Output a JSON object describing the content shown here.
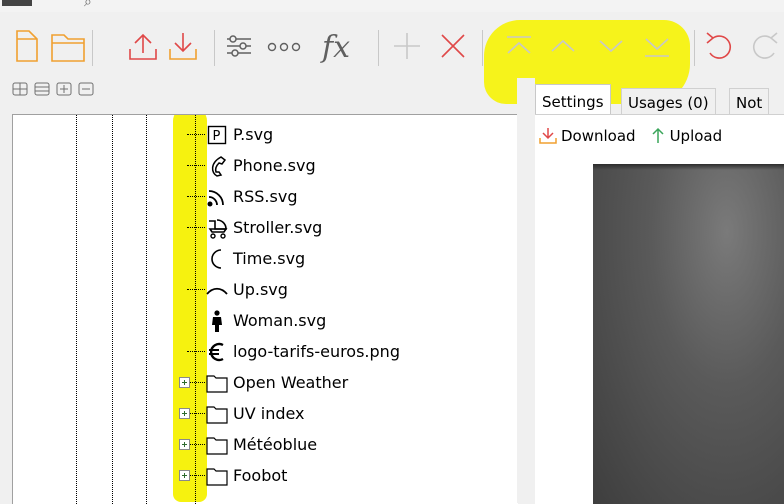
{
  "toolbar": {
    "buttons": [
      {
        "name": "new-file-button",
        "icon": "new-file-icon"
      },
      {
        "name": "open-folder-button",
        "icon": "folder-icon"
      },
      {
        "name": "export-button",
        "icon": "export-icon"
      },
      {
        "name": "import-button",
        "icon": "download-icon"
      },
      {
        "name": "settings-button",
        "icon": "sliders-icon"
      },
      {
        "name": "more-button",
        "icon": "dots-icon",
        "label": "ooo"
      },
      {
        "name": "formula-button",
        "icon": "function-icon",
        "label": "fx"
      },
      {
        "name": "add-button",
        "icon": "plus-icon"
      },
      {
        "name": "delete-button",
        "icon": "close-icon"
      },
      {
        "name": "move-top-button",
        "icon": "move-top-icon"
      },
      {
        "name": "move-up-button",
        "icon": "chevron-up-icon"
      },
      {
        "name": "move-down-button",
        "icon": "chevron-down-icon"
      },
      {
        "name": "move-bottom-button",
        "icon": "move-bottom-icon"
      },
      {
        "name": "undo-button",
        "icon": "undo-icon"
      },
      {
        "name": "redo-button",
        "icon": "redo-icon"
      }
    ],
    "colors": {
      "orange": "#f0a030",
      "red": "#e04848",
      "gray": "#c0c0c0",
      "dark": "#606060",
      "highlight": "#f6f20f"
    }
  },
  "tree": {
    "tools": [
      "expand-all-icon",
      "collapse-all-icon",
      "expand-icon",
      "collapse-icon"
    ],
    "items": [
      {
        "label": "P.svg",
        "icon": "parking-icon"
      },
      {
        "label": "Phone.svg",
        "icon": "phone-icon"
      },
      {
        "label": "RSS.svg",
        "icon": "rss-icon"
      },
      {
        "label": "Stroller.svg",
        "icon": "stroller-icon"
      },
      {
        "label": "Time.svg",
        "icon": "moon-icon"
      },
      {
        "label": "Up.svg",
        "icon": "chevron-up-icon"
      },
      {
        "label": "Woman.svg",
        "icon": "woman-icon"
      },
      {
        "label": "logo-tarifs-euros.png",
        "icon": "euro-icon"
      },
      {
        "label": "Open Weather",
        "icon": "folder-icon",
        "expandable": true
      },
      {
        "label": "UV index",
        "icon": "folder-icon",
        "expandable": true
      },
      {
        "label": "Météoblue",
        "icon": "folder-icon",
        "expandable": true
      },
      {
        "label": "Foobot",
        "icon": "folder-icon",
        "expandable": true
      }
    ]
  },
  "right": {
    "tabs": [
      {
        "label": "Settings",
        "active": true
      },
      {
        "label": "Usages (0)",
        "active": false
      },
      {
        "label": "Not",
        "active": false
      }
    ],
    "actions": {
      "download": "Download",
      "upload": "Upload"
    }
  }
}
